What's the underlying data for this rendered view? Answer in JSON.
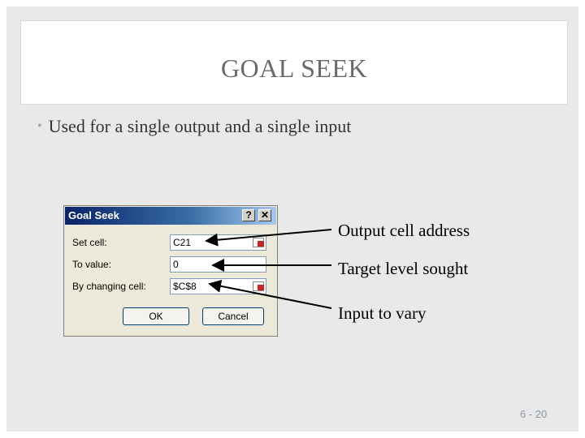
{
  "slide": {
    "title": "GOAL SEEK",
    "bullet": "Used for a single output and a single input",
    "page_number": "6 - 20"
  },
  "dialog": {
    "title": "Goal Seek",
    "help_button": "?",
    "close_button": "✕",
    "fields": [
      {
        "label": "Set cell:",
        "value": "C21"
      },
      {
        "label": "To value:",
        "value": "0"
      },
      {
        "label": "By changing cell:",
        "value": "$C$8"
      }
    ],
    "ok_label": "OK",
    "cancel_label": "Cancel"
  },
  "callouts": [
    "Output cell address",
    "Target level sought",
    "Input to vary"
  ],
  "colors": {
    "title_text": "#6b6b6b",
    "dialog_titlebar": "#0a246a",
    "dialog_background": "#ece9d8"
  }
}
